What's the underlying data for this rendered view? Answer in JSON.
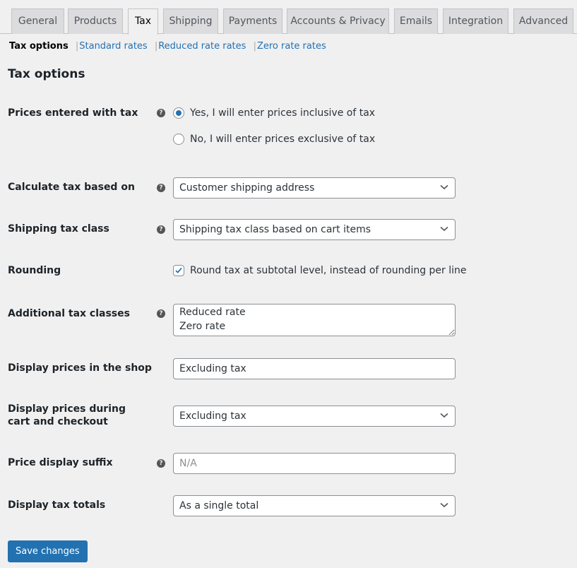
{
  "tabs": [
    {
      "label": "General",
      "active": false
    },
    {
      "label": "Products",
      "active": false
    },
    {
      "label": "Tax",
      "active": true
    },
    {
      "label": "Shipping",
      "active": false
    },
    {
      "label": "Payments",
      "active": false
    },
    {
      "label": "Accounts & Privacy",
      "active": false
    },
    {
      "label": "Emails",
      "active": false
    },
    {
      "label": "Integration",
      "active": false
    },
    {
      "label": "Advanced",
      "active": false
    }
  ],
  "subnav": {
    "current": "Tax options",
    "links": [
      "Standard rates",
      "Reduced rate rates",
      "Zero rate rates"
    ],
    "separator": "|"
  },
  "section_title": "Tax options",
  "help_glyph": "?",
  "fields": {
    "prices_entered": {
      "label": "Prices entered with tax",
      "options": [
        {
          "label": "Yes, I will enter prices inclusive of tax",
          "selected": true
        },
        {
          "label": "No, I will enter prices exclusive of tax",
          "selected": false
        }
      ]
    },
    "calculate_based_on": {
      "label": "Calculate tax based on",
      "value": "Customer shipping address"
    },
    "shipping_tax_class": {
      "label": "Shipping tax class",
      "value": "Shipping tax class based on cart items"
    },
    "rounding": {
      "label": "Rounding",
      "checkbox_label": "Round tax at subtotal level, instead of rounding per line",
      "checked": true
    },
    "additional_classes": {
      "label": "Additional tax classes",
      "value": "Reduced rate\nZero rate"
    },
    "display_shop": {
      "label": "Display prices in the shop",
      "value": "Excluding tax"
    },
    "display_cart": {
      "label": "Display prices during cart and checkout",
      "value": "Excluding tax"
    },
    "price_suffix": {
      "label": "Price display suffix",
      "placeholder": "N/A",
      "value": ""
    },
    "display_totals": {
      "label": "Display tax totals",
      "value": "As a single total"
    }
  },
  "save_label": "Save changes",
  "colors": {
    "accent": "#2271b1",
    "background": "#f0f0f1",
    "tab_inactive": "#dcdcde"
  }
}
